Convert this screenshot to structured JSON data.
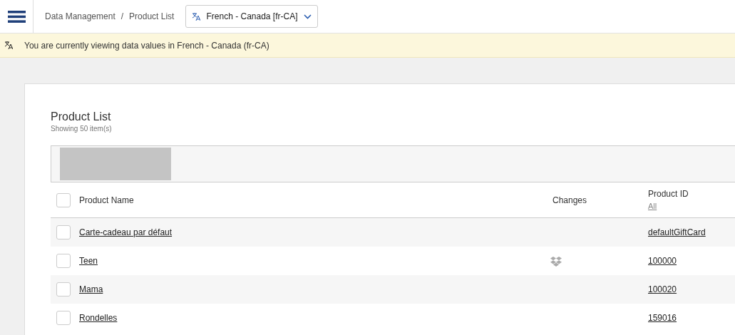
{
  "breadcrumb": {
    "separator": "/",
    "items": [
      {
        "label": "Data Management"
      },
      {
        "label": "Product List"
      }
    ]
  },
  "locale_select": {
    "value": "French - Canada [fr-CA]"
  },
  "banner": {
    "text": "You are currently viewing data values in French - Canada (fr-CA)"
  },
  "panel": {
    "title": "Product List",
    "subtitle": "Showing 50 item(s)"
  },
  "table": {
    "select_all": {
      "checked": false
    },
    "columns": [
      {
        "label": "Product Name"
      },
      {
        "label": "Changes"
      },
      {
        "label": "Product ID",
        "filter": "All"
      }
    ],
    "rows": [
      {
        "checked": false,
        "name": "Carte-cadeau par défaut",
        "changed": false,
        "id": "defaultGiftCard"
      },
      {
        "checked": false,
        "name": "Teen",
        "changed": true,
        "id": "100000"
      },
      {
        "checked": false,
        "name": "Mama",
        "changed": false,
        "id": "100020"
      },
      {
        "checked": false,
        "name": "Rondelles",
        "changed": false,
        "id": "159016"
      }
    ]
  }
}
